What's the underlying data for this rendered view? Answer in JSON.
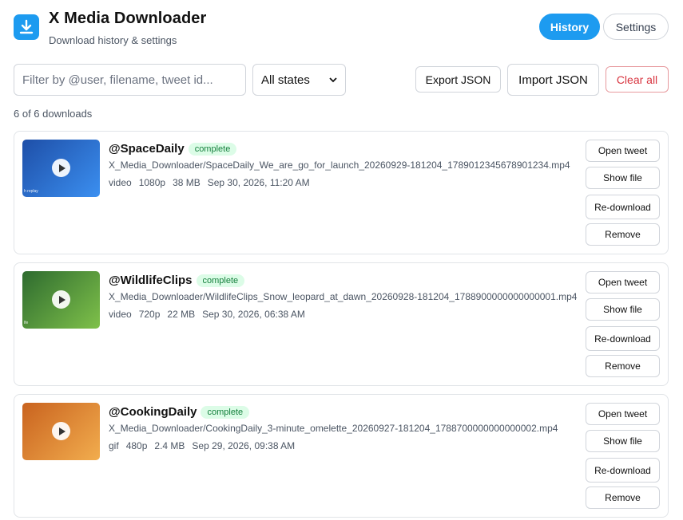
{
  "app": {
    "title": "X Media Downloader",
    "subtitle": "Download history & settings",
    "icon": "download-icon",
    "accent": "#1d9bf0"
  },
  "tabs": [
    {
      "label": "History",
      "active": true
    },
    {
      "label": "Settings",
      "active": false
    }
  ],
  "toolbar": {
    "search_placeholder": "Filter by @user, filename, tweet id...",
    "search_value": "",
    "state_filter": "All states",
    "export_label": "Export JSON",
    "import_label": "Import JSON",
    "clear_label": "Clear all"
  },
  "count_text": "6 of 6 downloads",
  "actions": {
    "open_tweet": "Open tweet",
    "show_file": "Show file",
    "redownload": "Re-download",
    "remove": "Remove"
  },
  "downloads": [
    {
      "handle": "@SpaceDaily",
      "status": "complete",
      "filename": "X_Media_Downloader/SpaceDaily_We_are_go_for_launch_20260929-181204_1789012345678901234.mp4",
      "type": "video",
      "resolution": "1080p",
      "size": "38 MB",
      "date": "Sep 30, 2026, 11:20 AM",
      "thumb_caption": "h replay",
      "thumb_colors": [
        "#1e4fa8",
        "#3b8ff0"
      ]
    },
    {
      "handle": "@WildlifeClips",
      "status": "complete",
      "filename": "X_Media_Downloader/WildlifeClips_Snow_leopard_at_dawn_20260928-181204_1788900000000000001.mp4",
      "type": "video",
      "resolution": "720p",
      "size": "22 MB",
      "date": "Sep 30, 2026, 06:38 AM",
      "thumb_caption": "lfe",
      "thumb_colors": [
        "#2e6b2f",
        "#7fc14a"
      ]
    },
    {
      "handle": "@CookingDaily",
      "status": "complete",
      "filename": "X_Media_Downloader/CookingDaily_3-minute_omelette_20260927-181204_1788700000000000002.mp4",
      "type": "gif",
      "resolution": "480p",
      "size": "2.4 MB",
      "date": "Sep 29, 2026, 09:38 AM",
      "thumb_caption": "",
      "thumb_colors": [
        "#c9631f",
        "#f2ad4e"
      ]
    }
  ]
}
